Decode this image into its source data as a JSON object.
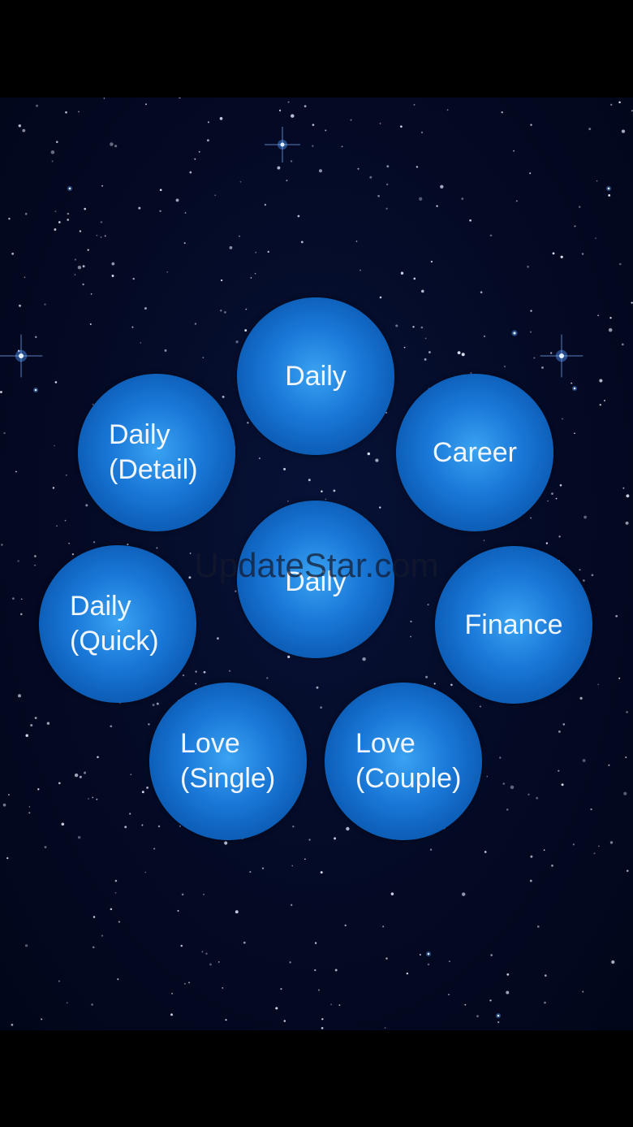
{
  "buttons": {
    "daily_top": "Daily",
    "career": "Career",
    "daily_detail": "Daily\n(Detail)",
    "daily_center": "Daily",
    "finance": "Finance",
    "daily_quick": "Daily\n(Quick)",
    "love_single": "Love\n(Single)",
    "love_couple": "Love\n(Couple)"
  },
  "watermark": "UpdateStar.com",
  "colors": {
    "background": "#02061a",
    "bubble": "#1a78d8",
    "bubble_highlight": "#3aa3f2",
    "text": "#f2f6ff"
  }
}
